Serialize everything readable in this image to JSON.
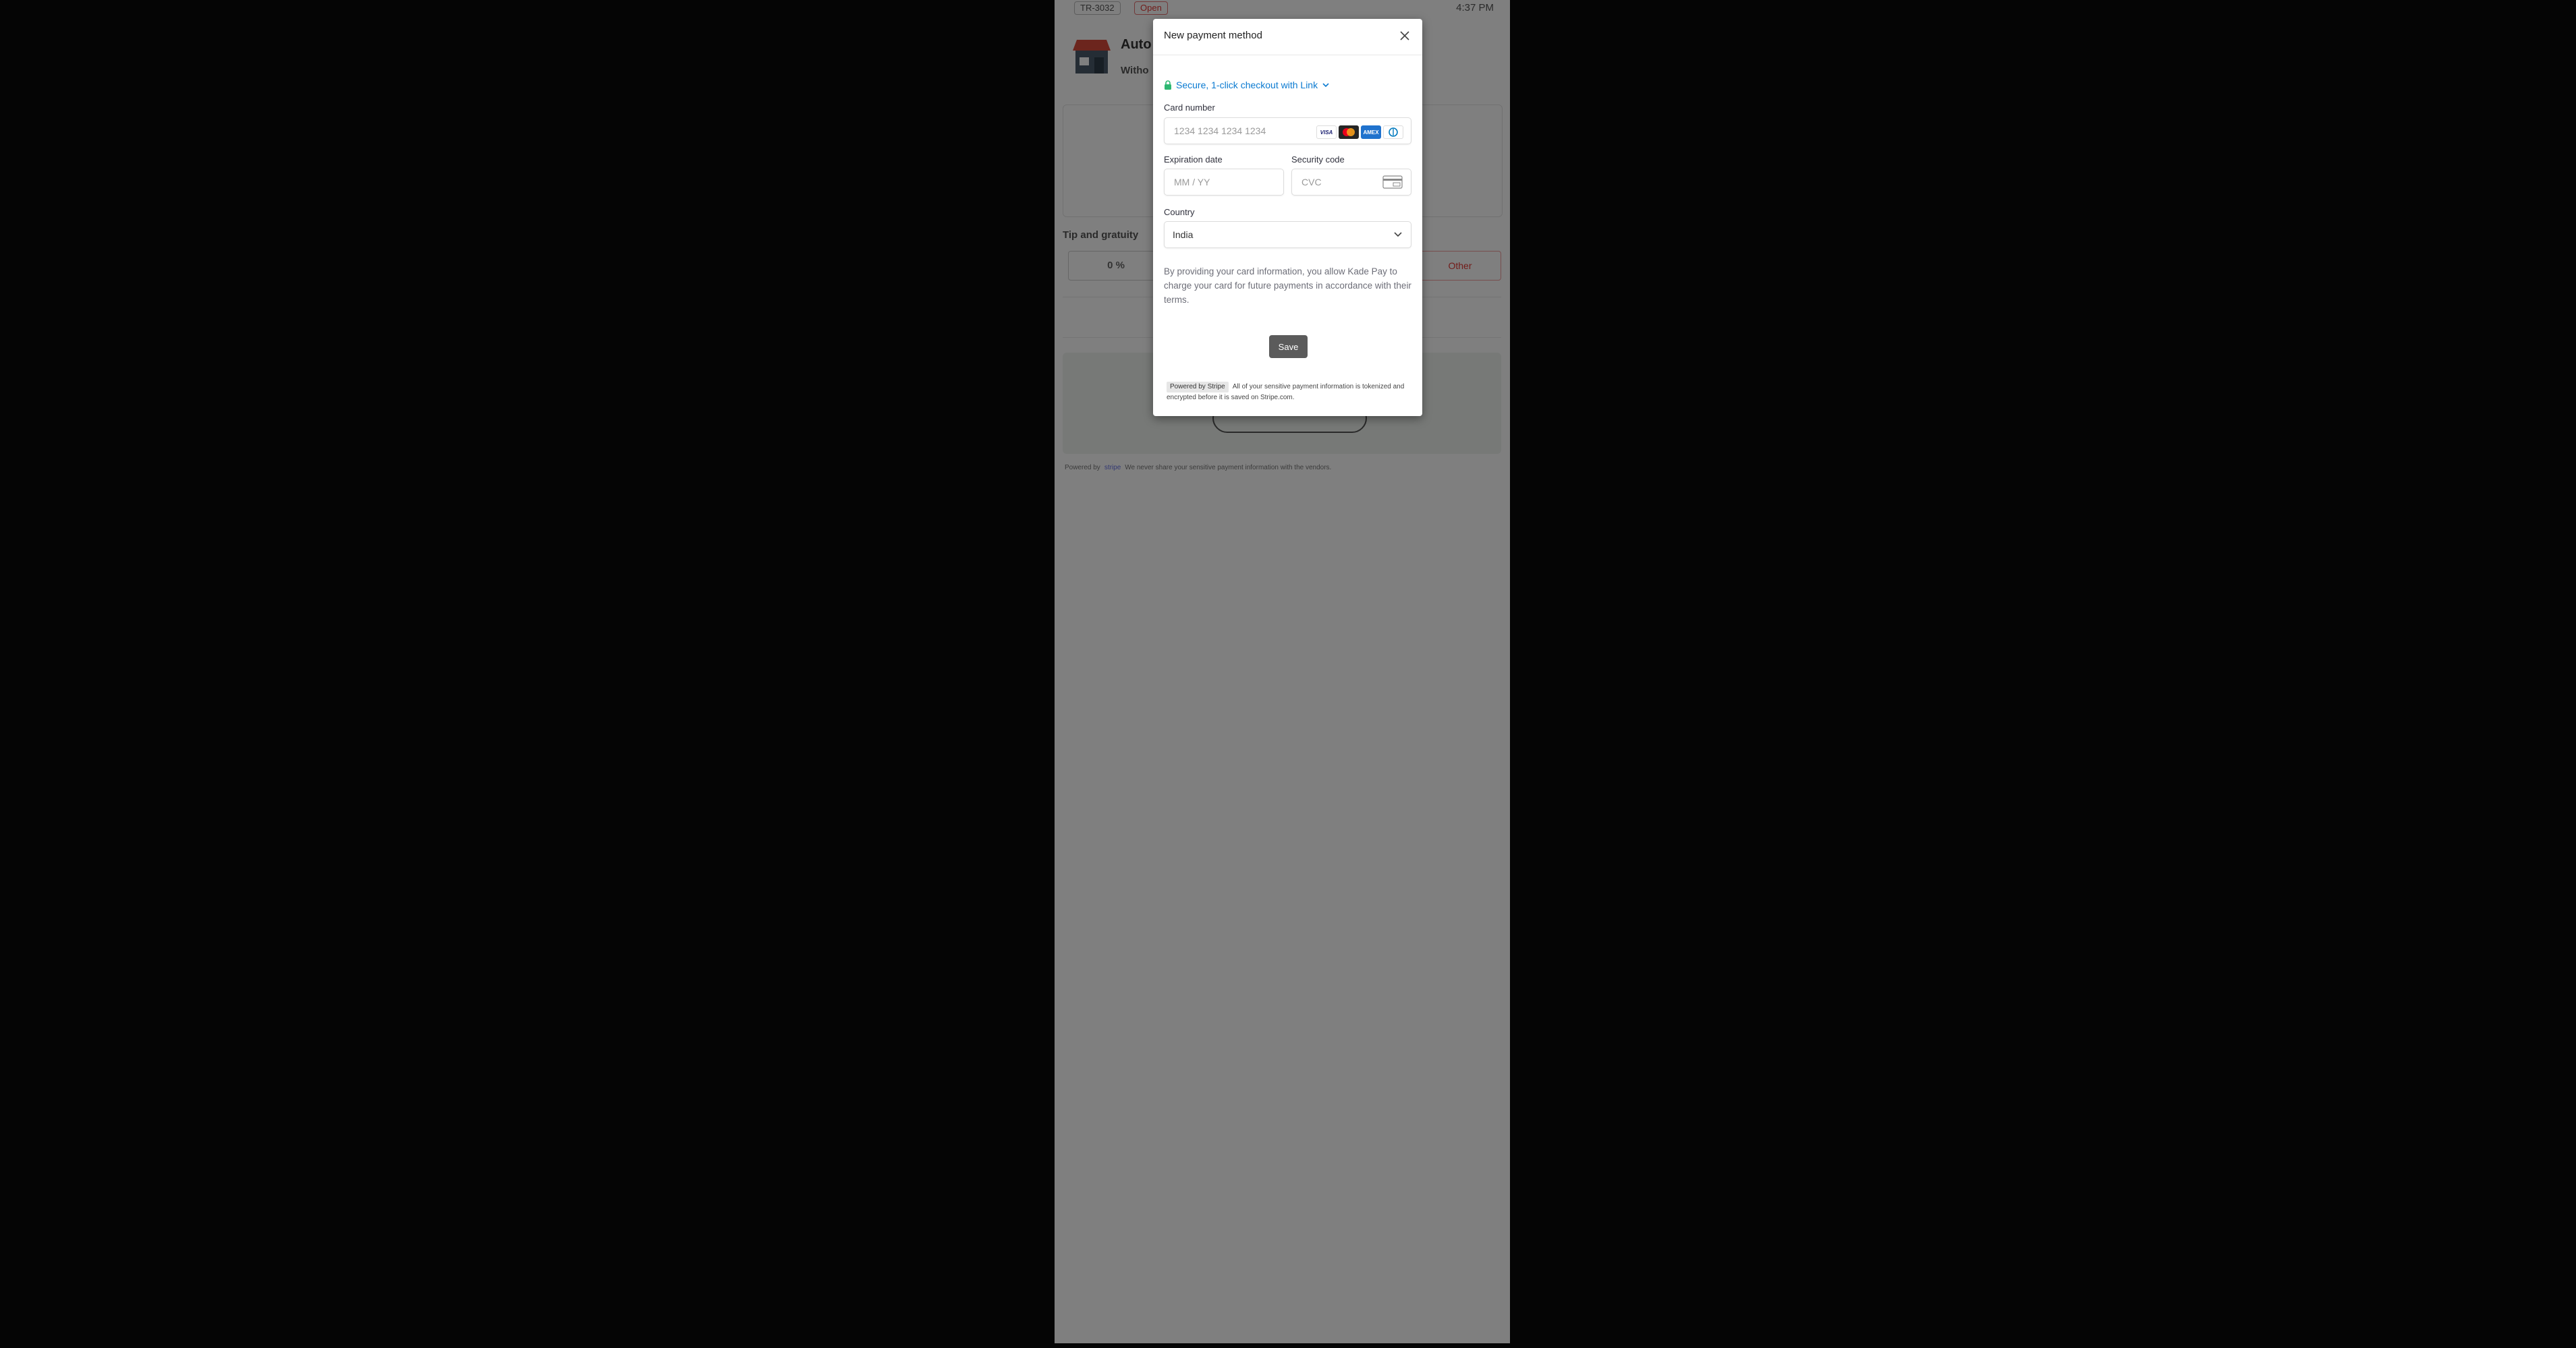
{
  "background_app": {
    "order_id": "TR-3032",
    "status_badge": "Open",
    "time": "4:37 PM",
    "store_name": "Auto",
    "store_subtitle": "Witho",
    "tip_label": "Tip and gratuity",
    "tip_option_1": "0 %",
    "tip_other": "Other",
    "footer_prefix": "Powered by",
    "footer_brand": "stripe",
    "footer_text": "We never share your sensitive payment information with the vendors."
  },
  "modal": {
    "title": "New payment method",
    "link_checkout": "Secure, 1-click checkout with Link",
    "card_number": {
      "label": "Card number",
      "placeholder": "1234 1234 1234 1234"
    },
    "card_brands": [
      "VISA",
      "mastercard",
      "AMEX",
      "diners"
    ],
    "expiration": {
      "label": "Expiration date",
      "placeholder": "MM / YY"
    },
    "security_code": {
      "label": "Security code",
      "placeholder": "CVC"
    },
    "country": {
      "label": "Country",
      "value": "India"
    },
    "terms": "By providing your card information, you allow Kade Pay to charge your card for future payments in accordance with their terms.",
    "save_label": "Save",
    "powered_badge": "Powered by Stripe",
    "powered_text": "All of your sensitive payment information is tokenized and encrypted before it is saved on Stripe.com."
  },
  "colors": {
    "link_blue": "#0a7ad1",
    "lock_green": "#2eb872",
    "save_button": "#5b5b5b",
    "overlay": "rgba(0,0,0,0.5)"
  }
}
